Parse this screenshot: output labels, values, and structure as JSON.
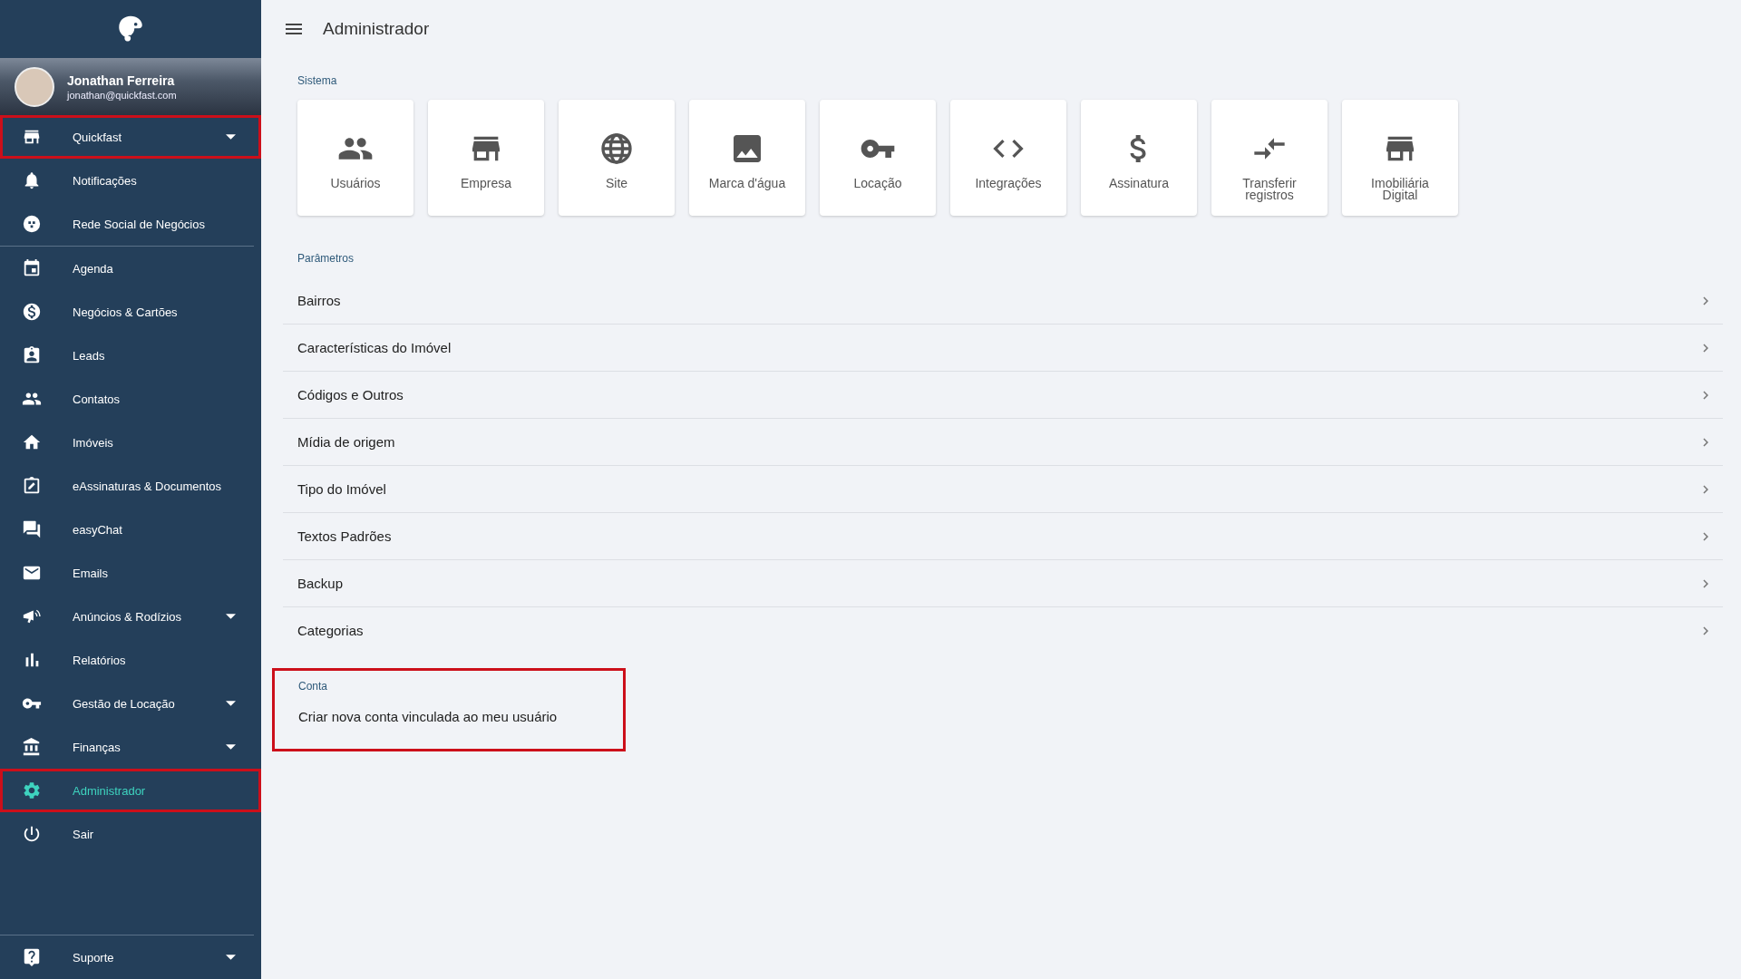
{
  "sidebar": {
    "profile": {
      "name": "Jonathan Ferreira",
      "email": "jonathan@quickfast.com"
    },
    "sections": [
      {
        "items": [
          {
            "label": "Quickfast",
            "expandable": true,
            "selected": false,
            "highlighted": true
          },
          {
            "label": "Notificações",
            "expandable": false,
            "selected": false,
            "highlighted": false
          },
          {
            "label": "Rede Social de Negócios",
            "expandable": false,
            "selected": false,
            "highlighted": false
          }
        ]
      },
      {
        "items": [
          {
            "label": "Agenda",
            "expandable": false,
            "selected": false,
            "highlighted": false
          },
          {
            "label": "Negócios & Cartões",
            "expandable": false,
            "selected": false,
            "highlighted": false
          },
          {
            "label": "Leads",
            "expandable": false,
            "selected": false,
            "highlighted": false
          },
          {
            "label": "Contatos",
            "expandable": false,
            "selected": false,
            "highlighted": false
          },
          {
            "label": "Imóveis",
            "expandable": false,
            "selected": false,
            "highlighted": false
          },
          {
            "label": "eAssinaturas & Documentos",
            "expandable": false,
            "selected": false,
            "highlighted": false
          },
          {
            "label": "easyChat",
            "expandable": false,
            "selected": false,
            "highlighted": false
          },
          {
            "label": "Emails",
            "expandable": false,
            "selected": false,
            "highlighted": false
          },
          {
            "label": "Anúncios & Rodízios",
            "expandable": true,
            "selected": false,
            "highlighted": false
          },
          {
            "label": "Relatórios",
            "expandable": false,
            "selected": false,
            "highlighted": false
          },
          {
            "label": "Gestão de Locação",
            "expandable": true,
            "selected": false,
            "highlighted": false
          },
          {
            "label": "Finanças",
            "expandable": true,
            "selected": false,
            "highlighted": false
          },
          {
            "label": "Administrador",
            "expandable": false,
            "selected": true,
            "highlighted": true
          },
          {
            "label": "Sair",
            "expandable": false,
            "selected": false,
            "highlighted": false
          }
        ]
      }
    ],
    "footer_item": {
      "label": "Suporte",
      "expandable": true,
      "selected": false,
      "highlighted": false
    }
  },
  "header": {
    "title": "Administrador"
  },
  "sistema": {
    "title": "Sistema",
    "tiles": [
      {
        "label": "Usuários"
      },
      {
        "label": "Empresa"
      },
      {
        "label": "Site"
      },
      {
        "label": "Marca d'água"
      },
      {
        "label": "Locação"
      },
      {
        "label": "Integrações"
      },
      {
        "label": "Assinatura"
      },
      {
        "label": "Transferir registros"
      },
      {
        "label": "Imobiliária Digital"
      }
    ]
  },
  "parametros": {
    "title": "Parâmetros",
    "rows": [
      "Bairros",
      "Características do Imóvel",
      "Códigos e Outros",
      "Mídia de origem",
      "Tipo do Imóvel",
      "Textos Padrões",
      "Backup",
      "Categorias"
    ]
  },
  "conta": {
    "title": "Conta",
    "highlighted": true,
    "rows": [
      "Criar nova conta vinculada ao meu usuário"
    ]
  }
}
